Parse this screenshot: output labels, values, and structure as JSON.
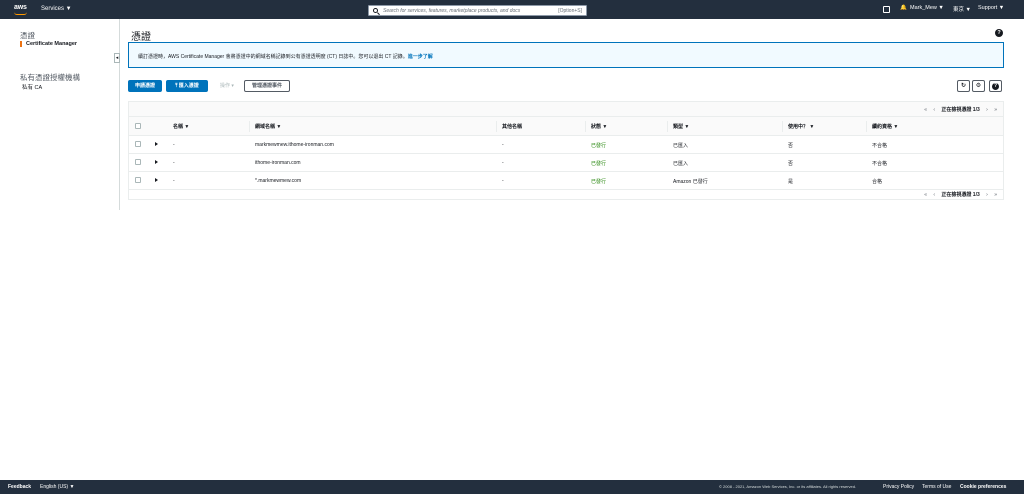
{
  "nav": {
    "logo": "aws",
    "services": "Services ▼",
    "search_placeholder": "Search for services, features, marketplace products, and docs",
    "search_shortcut": "[Option+S]",
    "bell": "🔔",
    "user": "Mark_Mew ▼",
    "region": "東京 ▼",
    "support": "Support ▼"
  },
  "sidebar": {
    "group1": "憑證",
    "active_item": "Certificate Manager",
    "group2": "私有憑證授權機構",
    "item2": "私有 CA",
    "collapse": "◂"
  },
  "page": {
    "title": "憑證",
    "help": "?"
  },
  "banner": {
    "text": "續訂憑證時，AWS Certificate Manager 會將憑證中的網域名稱記錄到公有憑證透明度 (CT) 日誌中。您可以退出 CT 記錄。",
    "link": "進一步了解"
  },
  "toolbar": {
    "request": "申請憑證",
    "import": "⤒ 匯入憑證",
    "actions": "操作 ▾",
    "manage": "管理憑證事件",
    "refresh": "↻",
    "settings": "⚙"
  },
  "table": {
    "pager": {
      "first": "«",
      "prev": "‹",
      "label": "正在檢視憑證 1/3",
      "next": "›",
      "last": "»"
    },
    "columns": [
      "名稱 ▼",
      "網域名稱 ▼",
      "其他名稱",
      "狀態 ▼",
      "類型 ▼",
      "使用中？ ▼",
      "續約資格 ▼"
    ],
    "rows": [
      {
        "name": "-",
        "domain": "markmewmew.ithome-ironman.com",
        "other": "-",
        "status": "已發行",
        "type": "已匯入",
        "in_use": "否",
        "renewal": "不合格"
      },
      {
        "name": "-",
        "domain": "ithome-ironman.com",
        "other": "-",
        "status": "已發行",
        "type": "已匯入",
        "in_use": "否",
        "renewal": "不合格"
      },
      {
        "name": "-",
        "domain": "*.markmewmew.com",
        "other": "-",
        "status": "已發行",
        "type": "Amazon 已發行",
        "in_use": "是",
        "renewal": "合格"
      }
    ]
  },
  "footer": {
    "feedback": "Feedback",
    "language": "English (US) ▼",
    "copyright": "© 2008 - 2021, Amazon Web Services, Inc. or its affiliates. All rights reserved.",
    "privacy": "Privacy Policy",
    "terms": "Terms of Use",
    "cookie": "Cookie preferences"
  }
}
